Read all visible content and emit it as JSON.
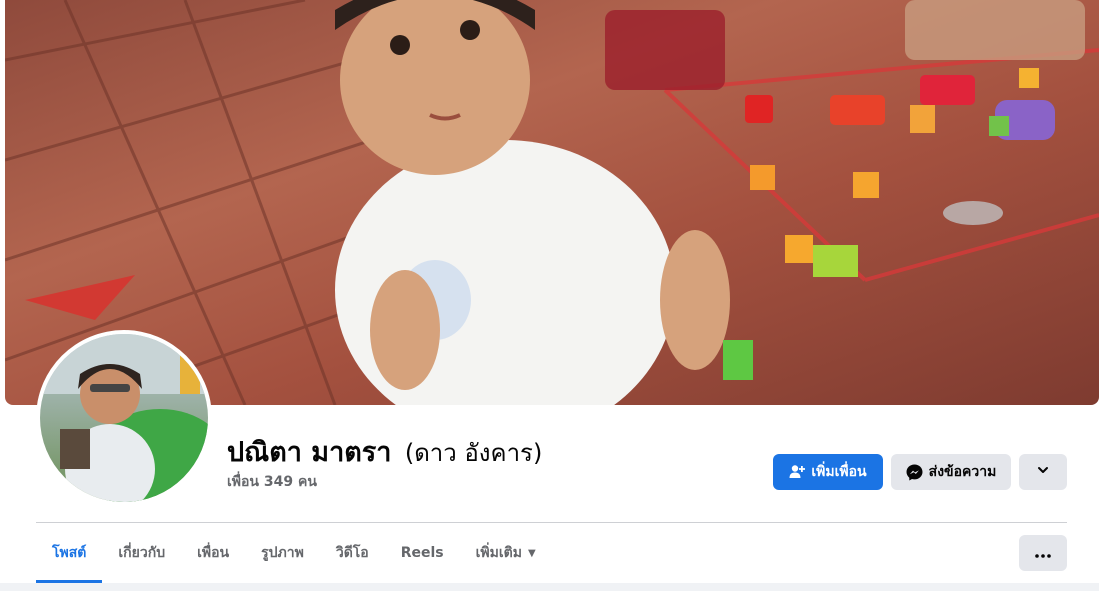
{
  "profile": {
    "name": "ปณิตา มาตรา",
    "alternate_name": "(ดาว อังคาร)",
    "friends_text": "เพื่อน 349 คน"
  },
  "actions": {
    "add_friend_label": "เพิ่มเพื่อน",
    "message_label": "ส่งข้อความ"
  },
  "tabs": [
    {
      "label": "โพสต์",
      "active": true
    },
    {
      "label": "เกี่ยวกับ"
    },
    {
      "label": "เพื่อน"
    },
    {
      "label": "รูปภาพ"
    },
    {
      "label": "วิดีโอ"
    },
    {
      "label": "Reels"
    },
    {
      "label": "เพิ่มเติม"
    }
  ],
  "icons": {
    "add_friend": "person-plus-icon",
    "message": "messenger-icon",
    "chevron": "chevron-down-icon",
    "more": "ellipsis-icon"
  },
  "colors": {
    "accent": "#1b74e4",
    "secondary_button": "#e4e6eb"
  }
}
